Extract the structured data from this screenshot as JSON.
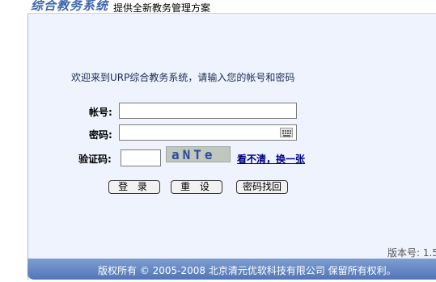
{
  "header": {
    "logo_text": "综合教务系统",
    "tagline": "提供全新教务管理方案"
  },
  "login": {
    "welcome": "欢迎来到URP综合教务系统，请输入您的帐号和密码",
    "account_label": "帐号:",
    "account_value": "",
    "password_label": "密码:",
    "password_value": "",
    "captcha_label": "验证码:",
    "captcha_value": "",
    "captcha_image_text": "aNTe",
    "refresh_captcha_link": "看不清，换一张",
    "login_button": "登 录",
    "reset_button": "重 设",
    "recover_button": "密码找回"
  },
  "version_label": "版本号: 1.5",
  "footer": {
    "copyright": "版权所有 © 2005-2008 北京清元优软科技有限公司 保留所有权利。"
  },
  "colors": {
    "panel_bg": "#eef3fd",
    "footer_bar": "#5f82c0",
    "logo": "#3d66ad",
    "link": "#000080"
  }
}
